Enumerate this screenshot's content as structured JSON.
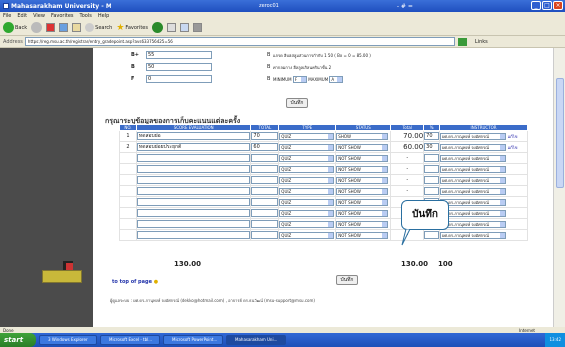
{
  "window": {
    "title": "Mahasarakham University - Microsoft In",
    "tab_center": "zeroc01",
    "tab_right": "- # =",
    "menu": [
      "File",
      "Edit",
      "View",
      "Favorites",
      "Tools",
      "Help"
    ]
  },
  "toolbar": {
    "back_label": "Back",
    "search_label": "Search",
    "favorites_label": "Favorites"
  },
  "address": {
    "label": "Address",
    "url": "https://reg.msu.ac.th/registrar/entry_gradepoint.asp?avs633756425=56",
    "links_label": "Links"
  },
  "grades": [
    {
      "grade": "B+",
      "min": "55",
      "opt": "B",
      "note": "แกรด ฮิบฮสลูมส่วนการกำกับ 1 50 ( Bx = 0 = 85.00 )"
    },
    {
      "grade": "B",
      "min": "50",
      "opt": "B",
      "note": "ค่ากลมกาง ฮีลลูลเกิลนครินาขั้น 2"
    },
    {
      "grade": "F",
      "min": "0",
      "opt": "B",
      "note": "MINIMUM",
      "sel1": "F",
      "note2": "MAXIMUM",
      "sel2": "A"
    }
  ],
  "save_top_label": "บันทึก",
  "section_heading": "กรุณาระบุข้อมูลของการเก็บคะแนนแต่ละครั้ง",
  "table": {
    "headers": [
      "NO.",
      "SCORE EVALUATION",
      "TOTAL",
      "TYPE",
      "STATUS",
      "Total",
      "%",
      "INSTRUCTOR"
    ],
    "rows": [
      {
        "no": "1",
        "name": "ทดสอบย่อ",
        "total": "70",
        "type": "QUIZ",
        "status": "SHOW",
        "tot": "70.00",
        "pct": "70",
        "instructor": "ผศ.ดร.ภาณุพงษ์ จงอัศกรณ์",
        "tag": "แก้ไข"
      },
      {
        "no": "2",
        "name": "ทดสอบย่อยประยุกต์",
        "total": "60",
        "type": "QUIZ",
        "status": "NOT SHOW",
        "tot": "60.00",
        "pct": "30",
        "instructor": "ผศ.ดร.ภาณุพงษ์ จงอัศกรณ์",
        "tag": "แก้ไข"
      }
    ],
    "empty_type": "QUIZ",
    "empty_status": "NOT SHOW",
    "empty_dash": "-",
    "empty_instructor": "ผศ.ดร.ภาณุพงษ์ จงอัศกรณ์",
    "sum_total": "130.00",
    "sum_tot": "130.00",
    "sum_pct": "100"
  },
  "callout_text": "บันทึก",
  "save_bottom_label": "บันทึก",
  "top_of_page": "to top of page",
  "footer": "ผู้ดูแลระบบ : ผศ.ดร.ภานุพงษ์ จงอัศกรณ์ (dekko@hotmail.com) , อาจารย์ ดร.ธนวัฒน์ (msu-support@msu.com)",
  "status": {
    "done": "Done",
    "zone": "Internet"
  },
  "taskbar": {
    "start": "start",
    "items": [
      "3 Windows Explorer",
      "Microsoft Excel - tbl...",
      "Microsoft PowerPoint...",
      "Mahasarakham Uni..."
    ],
    "clock": "13:42"
  }
}
